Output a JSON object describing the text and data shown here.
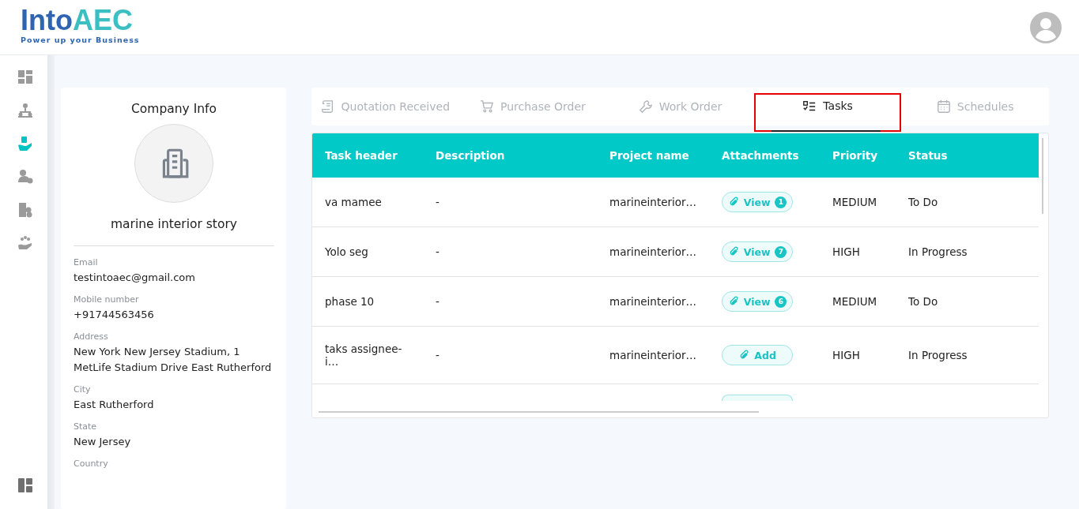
{
  "logo": {
    "name_a": "Into",
    "name_b": "AEC",
    "tagline": "Power up your Business"
  },
  "sidebar": {
    "items": [
      {
        "kind": "dashboard",
        "selected": false
      },
      {
        "kind": "hierarchy",
        "selected": false
      },
      {
        "kind": "hand",
        "selected": true
      },
      {
        "kind": "people",
        "selected": false
      },
      {
        "kind": "building",
        "selected": false
      },
      {
        "kind": "team",
        "selected": false
      }
    ],
    "bottom": {
      "kind": "layout"
    }
  },
  "company": {
    "title": "Company Info",
    "name": "marine interior story",
    "fields": [
      {
        "label": "Email",
        "value": "testintoaec@gmail.com"
      },
      {
        "label": "Mobile number",
        "value": "+91744563456"
      },
      {
        "label": "Address",
        "value": "New York New Jersey Stadium, 1 MetLife Stadium Drive East Rutherford"
      },
      {
        "label": "City",
        "value": "East Rutherford"
      },
      {
        "label": "State",
        "value": "New Jersey"
      },
      {
        "label": "Country"
      }
    ]
  },
  "tabs": [
    {
      "label": "Quotation Received",
      "kind": "scroll",
      "selected": false,
      "highlighted": false
    },
    {
      "label": "Purchase Order",
      "kind": "cart",
      "selected": false,
      "highlighted": false
    },
    {
      "label": "Work Order",
      "kind": "wrench",
      "selected": false,
      "highlighted": false
    },
    {
      "label": "Tasks",
      "kind": "checklist",
      "selected": true,
      "highlighted": true
    },
    {
      "label": "Schedules",
      "kind": "calendar",
      "selected": false,
      "highlighted": false
    }
  ],
  "table": {
    "columns": [
      "Task header",
      "Description",
      "Project name",
      "Attachments",
      "Priority",
      "Status"
    ],
    "rows": [
      {
        "task": "va mamee",
        "description": "-",
        "project": "marineinterior…",
        "attachment": {
          "kind": "view",
          "label": "View",
          "count": "1"
        },
        "priority": "MEDIUM",
        "status": "To Do"
      },
      {
        "task": "Yolo seg",
        "description": "-",
        "project": "marineinterior…",
        "attachment": {
          "kind": "view",
          "label": "View",
          "count": "7"
        },
        "priority": "HIGH",
        "status": "In Progress"
      },
      {
        "task": "phase 10",
        "description": "-",
        "project": "marineinterior…",
        "attachment": {
          "kind": "view",
          "label": "View",
          "count": "6"
        },
        "priority": "MEDIUM",
        "status": "To Do"
      },
      {
        "task": "taks assignee-i…",
        "description": "-",
        "project": "marineinterior…",
        "attachment": {
          "kind": "add",
          "label": "Add"
        },
        "priority": "HIGH",
        "status": "In Progress"
      }
    ]
  }
}
